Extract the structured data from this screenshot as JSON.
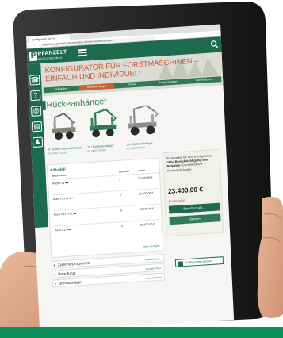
{
  "browser": {
    "tab_title": "Konfigurator für Fo",
    "tab_close": "×",
    "url": "https://www.pfanzelt-maschinenbau.de/de/rueckeanhaenger/",
    "back": "←",
    "forward": "→",
    "reload": "↻"
  },
  "header": {
    "logo_letter": "P",
    "logo_name": "PFANZELT",
    "logo_sub": "MASCHINENBAU"
  },
  "sidebar": {
    "phone": "☎",
    "info": "?",
    "mail": "@",
    "docs": "▤",
    "person": "♟"
  },
  "hero": {
    "title": "KONFIGURATOR FÜR FORSTMASCHINEN – EINFACH UND INDIVIDUELL",
    "steps": [
      "Seilwinden",
      "Rückeanhänger",
      "Kräne",
      "Forstschlepper",
      "Forstmulcher"
    ]
  },
  "section": {
    "title": "Rückeanhänger"
  },
  "models": [
    {
      "name": "9 Tonnen Rückeanhänger",
      "desc": "Nr. 1170 PZ3000"
    },
    {
      "name": "11 t Rückeanhänger",
      "desc": "Nr. 1182 PZ4000"
    },
    {
      "name": "14 t Rückeanhänger",
      "desc": "Nr. 1184 PZ5000"
    }
  ],
  "panel": {
    "header": "Modell",
    "columns": [
      "Bezeichnung",
      "Auswahl",
      "Preis"
    ],
    "rows": [
      {
        "name": "Rück P11 ●●",
        "count": "0",
        "price": "23.400,00 €"
      },
      {
        "name": "Rück P11 Profi ●●",
        "count": "0",
        "price": "26.800,00 €"
      },
      {
        "name": "Rück P13 Profi ●●",
        "count": "0",
        "price": "30.100,00 €"
      },
      {
        "name": "Rück P17 ●●",
        "count": "0",
        "price": "35.200,00 €"
      }
    ],
    "link": "mehr anzeigen"
  },
  "accordion": [
    {
      "label": "Zubehörprogramm",
      "link": "Auswahl öffnen"
    },
    {
      "label": "Bereifung",
      "link": "Auswahl öffnen"
    },
    {
      "label": "Bremsanlage",
      "link": "Auswahl öffnen"
    }
  ],
  "price_box": {
    "intro": "Ihr Angebot für Ihre Konfiguration",
    "bold": "ohne Berücksichtigung von Rabatten",
    "after": "(Unverbindliche Preisempfehlung)",
    "price": "23.400,00 €",
    "label": "Konfiguration",
    "btn_save": "Speichern als ...",
    "btn_send": "Senden"
  },
  "bottom_button": {
    "label": "Konfiguration drucken"
  },
  "colors": {
    "brand_green": "#1d6a4f",
    "accent_orange": "#c65a2e",
    "strip_green": "#0c8f5a"
  }
}
